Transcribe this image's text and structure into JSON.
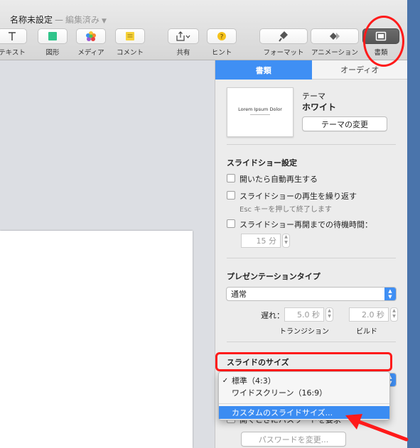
{
  "window": {
    "document_title": "名称未設定",
    "separator": "—",
    "status": "編集済み"
  },
  "toolbar": {
    "items": [
      {
        "label": "テキスト",
        "icon": "text-icon"
      },
      {
        "label": "図形",
        "icon": "shape-icon"
      },
      {
        "label": "メディア",
        "icon": "media-icon"
      },
      {
        "label": "コメント",
        "icon": "comment-icon"
      },
      {
        "label": "共有",
        "icon": "share-icon"
      },
      {
        "label": "ヒント",
        "icon": "tips-icon"
      },
      {
        "label": "フォーマット",
        "icon": "format-icon"
      },
      {
        "label": "アニメーション",
        "icon": "animate-icon"
      },
      {
        "label": "書類",
        "icon": "document-icon",
        "active": true
      }
    ]
  },
  "inspector": {
    "tabs": [
      "書類",
      "オーディオ"
    ],
    "theme": {
      "label": "テーマ",
      "name": "ホワイト",
      "thumbnail_text": "Lorem Ipsum Dolor",
      "change_button": "テーマの変更"
    },
    "slideshow": {
      "heading": "スライドショー設定",
      "autoplay": "開いたら自動再生する",
      "loop": "スライドショーの再生を繰り返す",
      "loop_hint": "Esc キーを押して終了します",
      "restart": "スライドショー再開までの待機時間：",
      "restart_value": "15 分"
    },
    "presentation": {
      "heading": "プレゼンテーションタイプ",
      "type": "通常",
      "delay_label": "遅れ：",
      "transition_value": "5.0 秒",
      "build_value": "2.0 秒",
      "transition_label": "トランジション",
      "build_label": "ビルド"
    },
    "slide_size": {
      "heading": "スライドのサイズ",
      "options": [
        {
          "label": "標準（4:3）",
          "checked": true
        },
        {
          "label": "ワイドスクリーン（16:9）",
          "checked": false
        }
      ],
      "custom_option": "カスタムのスライドサイズ...",
      "partial_row": "開くときにパスワードを要求",
      "password_button": "パスワードを変更..."
    }
  },
  "annotation_colors": {
    "highlight": "#ff1a1a",
    "accent": "#3f8ff4"
  }
}
